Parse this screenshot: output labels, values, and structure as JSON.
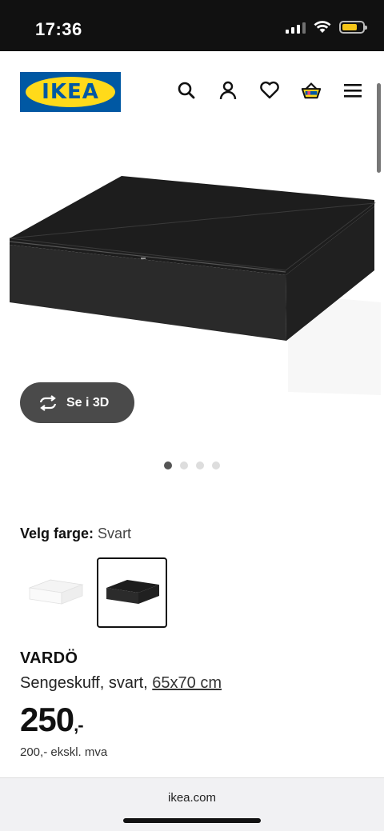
{
  "status": {
    "time": "17:36",
    "battery_level": 0.75,
    "battery_color": "#f5c518"
  },
  "header": {
    "logo_text": "IKEA",
    "brand_blue": "#0058a3",
    "brand_yellow": "#ffda1a",
    "icons": [
      "search-icon",
      "user-icon",
      "heart-icon",
      "basket-icon",
      "menu-icon"
    ]
  },
  "gallery": {
    "view_3d_label": "Se i 3D",
    "dot_count": 4,
    "active_dot": 1
  },
  "color": {
    "label": "Velg farge:",
    "value": "Svart",
    "options": [
      "white",
      "black"
    ],
    "selected": "black"
  },
  "product": {
    "name": "VARDÖ",
    "description": "Sengeskuff, svart,",
    "size": "65x70 cm",
    "price": "250",
    "price_suffix": ",-",
    "ex_vat": "200,- ekskl. mva"
  },
  "browser": {
    "url": "ikea.com"
  }
}
